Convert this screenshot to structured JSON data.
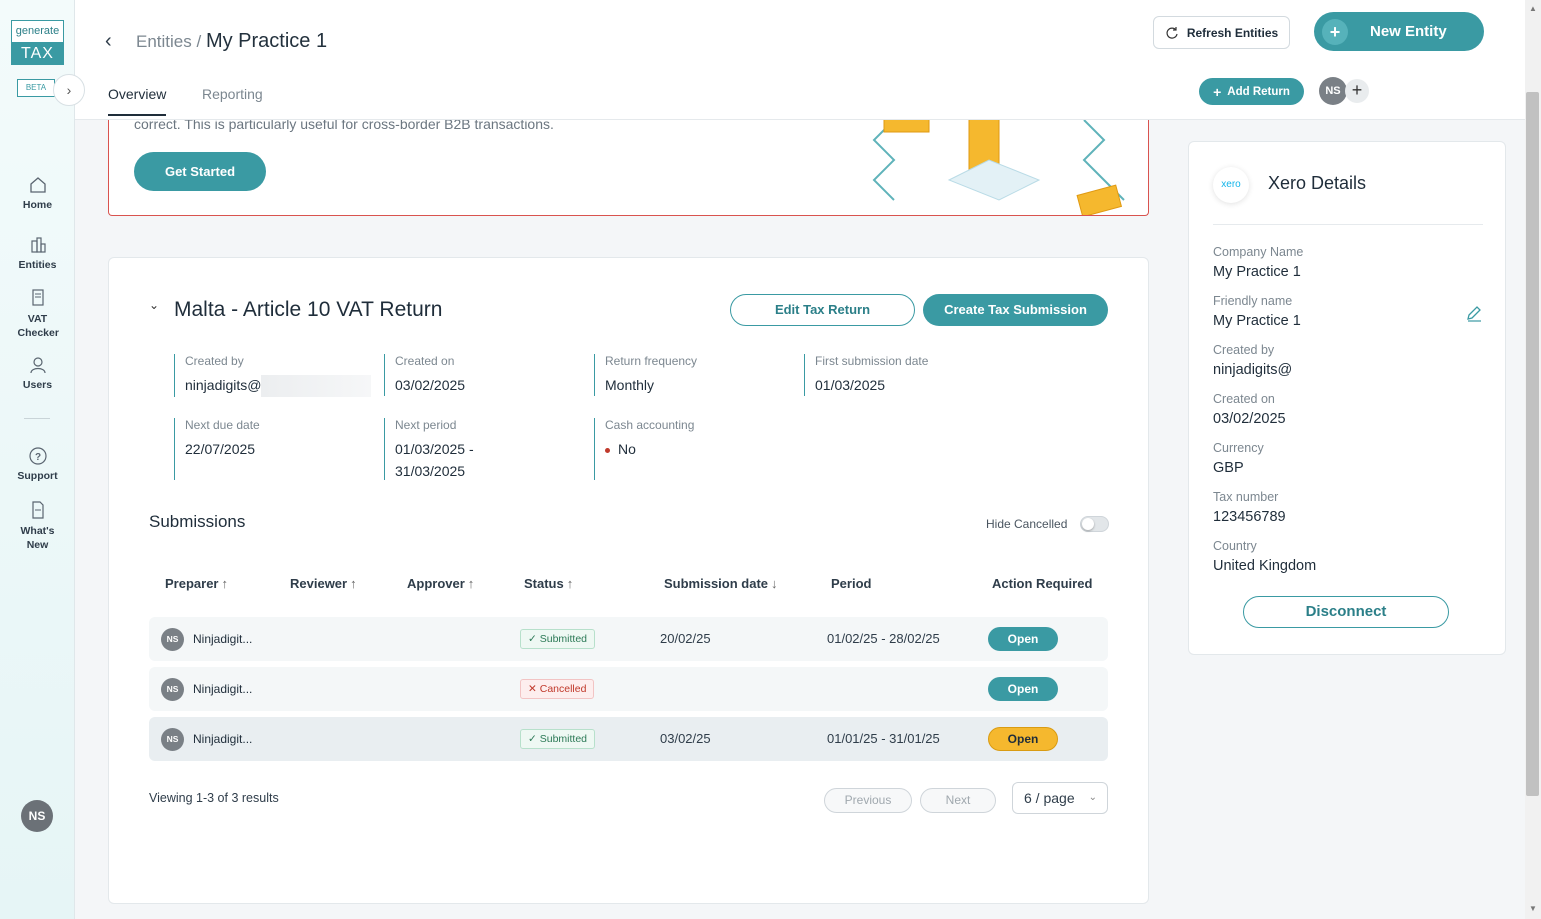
{
  "brand": {
    "logo_top": "generate",
    "logo_bottom": "TAX",
    "beta": "BETA"
  },
  "sidebar": {
    "items": [
      {
        "label": "Home"
      },
      {
        "label": "Entities"
      },
      {
        "label": "VAT Checker"
      },
      {
        "label": "Users"
      },
      {
        "label": "Support"
      },
      {
        "label": "What's New"
      }
    ],
    "user_initials": "NS"
  },
  "header": {
    "breadcrumb_parent": "Entities",
    "breadcrumb_sep": "/",
    "title": "My Practice 1",
    "tabs": [
      {
        "label": "Overview"
      },
      {
        "label": "Reporting"
      }
    ],
    "refresh_label": "Refresh Entities",
    "new_entity_label": "New Entity",
    "add_return_label": "Add Return",
    "avatar_initials": "NS"
  },
  "banner": {
    "text": "correct. This is particularly useful for cross-border B2B transactions.",
    "button_label": "Get Started"
  },
  "return_card": {
    "title": "Malta - Article 10 VAT Return",
    "edit_label": "Edit Tax Return",
    "create_label": "Create Tax Submission",
    "fields": {
      "created_by": {
        "label": "Created by",
        "value": "ninjadigits@"
      },
      "created_on": {
        "label": "Created on",
        "value": "03/02/2025"
      },
      "return_frequency": {
        "label": "Return frequency",
        "value": "Monthly"
      },
      "first_submission": {
        "label": "First submission date",
        "value": "01/03/2025"
      },
      "next_due": {
        "label": "Next due date",
        "value": "22/07/2025"
      },
      "next_period": {
        "label": "Next period",
        "value_line1": "01/03/2025 -",
        "value_line2": "31/03/2025"
      },
      "cash_accounting": {
        "label": "Cash accounting",
        "value": "No"
      }
    }
  },
  "submissions": {
    "title": "Submissions",
    "hide_cancelled_label": "Hide Cancelled",
    "columns": [
      "Preparer",
      "Reviewer",
      "Approver",
      "Status",
      "Submission date",
      "Period",
      "Action Required"
    ],
    "rows": [
      {
        "initials": "NS",
        "preparer": "Ninjadigit...",
        "status": "Submitted",
        "submission_date": "20/02/25",
        "period": "01/02/25 - 28/02/25",
        "action": "Open"
      },
      {
        "initials": "NS",
        "preparer": "Ninjadigit...",
        "status": "Cancelled",
        "submission_date": "",
        "period": "",
        "action": "Open"
      },
      {
        "initials": "NS",
        "preparer": "Ninjadigit...",
        "status": "Submitted",
        "submission_date": "03/02/25",
        "period": "01/01/25 - 31/01/25",
        "action": "Open"
      }
    ],
    "viewing": "Viewing 1-3 of 3 results",
    "previous_label": "Previous",
    "next_label": "Next",
    "per_page": "6 / page"
  },
  "xero": {
    "logo_text": "xero",
    "title": "Xero Details",
    "company_name": {
      "label": "Company Name",
      "value": "My Practice 1"
    },
    "friendly_name": {
      "label": "Friendly name",
      "value": "My Practice 1"
    },
    "created_by": {
      "label": "Created by",
      "value": "ninjadigits@"
    },
    "created_on": {
      "label": "Created on",
      "value": "03/02/2025"
    },
    "currency": {
      "label": "Currency",
      "value": "GBP"
    },
    "tax_number": {
      "label": "Tax number",
      "value": "123456789"
    },
    "country": {
      "label": "Country",
      "value": "United Kingdom"
    },
    "disconnect_label": "Disconnect"
  },
  "colors": {
    "accent": "#3a9aa3",
    "warning": "#f5b82e",
    "danger": "#d9534f"
  },
  "icons": [
    "chevron-left-icon",
    "chevron-right-icon",
    "home-icon",
    "entities-icon",
    "vat-checker-icon",
    "users-icon",
    "support-icon",
    "whats-new-icon",
    "refresh-icon",
    "plus-icon",
    "chevron-down-icon",
    "sort-up-icon",
    "sort-down-icon",
    "check-icon",
    "x-icon",
    "pencil-icon"
  ]
}
